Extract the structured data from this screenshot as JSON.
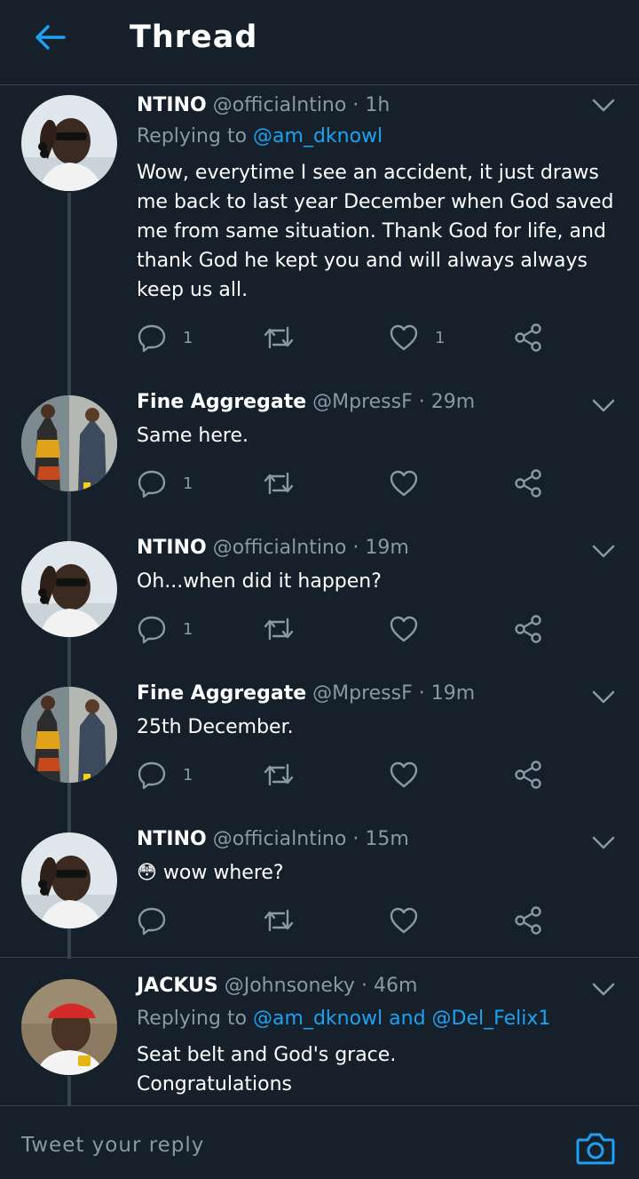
{
  "header": {
    "title": "Thread",
    "back_icon": "arrow-left-icon",
    "accent": "#1da1f2"
  },
  "tweets": [
    {
      "name": "NTINO",
      "handle": "@officialntino",
      "dot": "·",
      "time": "1h",
      "reply_prefix": "Replying to ",
      "reply_mentions": "@am_dknowl",
      "text": "Wow, everytime I see an accident, it just draws me back to last year December when God saved me from same situation. Thank God for life, and thank God he kept you  and will always always keep us all.",
      "reply_count": "1",
      "like_count": "1"
    },
    {
      "name": "Fine Aggregate",
      "handle": "@MpressF",
      "dot": "·",
      "time": "29m",
      "text": "Same here.",
      "reply_count": "1",
      "like_count": ""
    },
    {
      "name": "NTINO",
      "handle": "@officialntino",
      "dot": "·",
      "time": "19m",
      "text": "Oh...when did it happen?",
      "reply_count": "1",
      "like_count": ""
    },
    {
      "name": "Fine Aggregate",
      "handle": "@MpressF",
      "dot": "·",
      "time": "19m",
      "text": "25th December.",
      "reply_count": "1",
      "like_count": ""
    },
    {
      "name": "NTINO",
      "handle": "@officialntino",
      "dot": "·",
      "time": "15m",
      "text": "😳 wow where?",
      "reply_count": "",
      "like_count": ""
    },
    {
      "name": "JACKUS",
      "handle": "@Johnsoneky",
      "dot": "·",
      "time": "46m",
      "reply_prefix": "Replying to ",
      "reply_mentions": "@am_dknowl and @Del_Felix1",
      "text": "Seat belt and God's grace.\nCongratulations",
      "reply_count": "",
      "like_count": ""
    }
  ],
  "composer": {
    "placeholder": "Tweet your reply",
    "camera_icon": "camera-icon"
  },
  "icons": {
    "reply": "reply-icon",
    "retweet": "retweet-icon",
    "like": "heart-icon",
    "share": "share-icon",
    "caret": "chevron-down-icon"
  }
}
